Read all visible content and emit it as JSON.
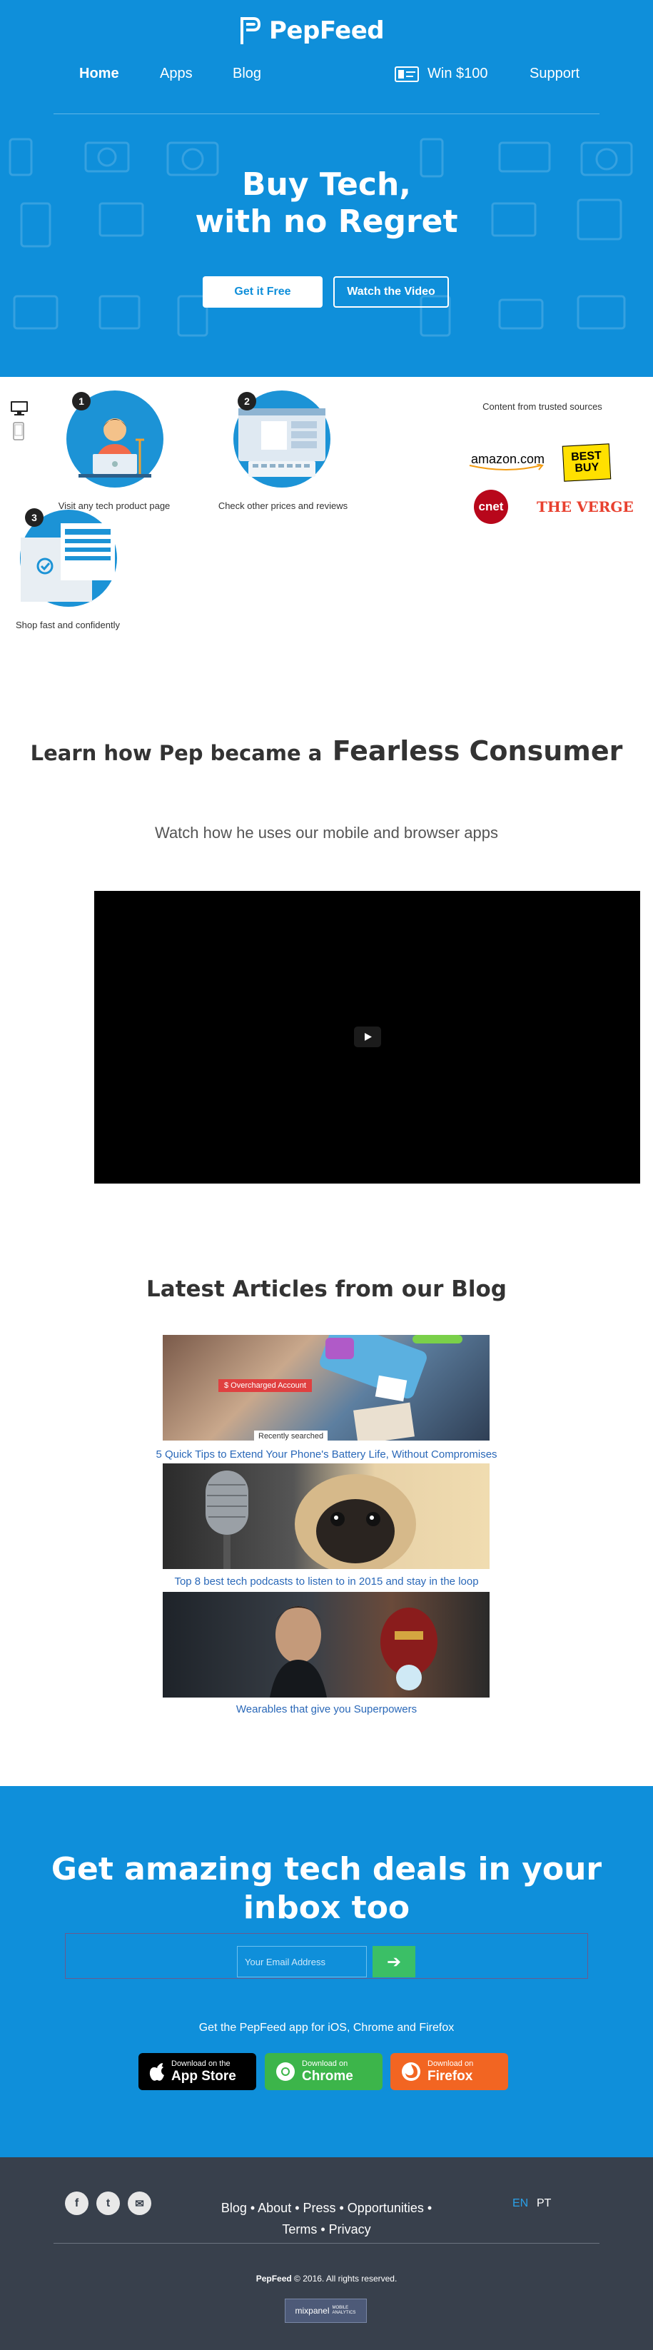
{
  "header": {
    "logo_text": "PepFeed",
    "nav": [
      {
        "label": "Home"
      },
      {
        "label": "Apps"
      },
      {
        "label": "Blog"
      },
      {
        "label": "Win $100",
        "icon": "ticket-icon"
      },
      {
        "label": "Support"
      }
    ]
  },
  "hero": {
    "title_line1": "Buy Tech,",
    "title_line2": "with no Regret",
    "cta_primary": "Get it Free",
    "cta_secondary": "Watch the Video"
  },
  "steps": {
    "device_icons": [
      "desktop-icon",
      "mobile-icon"
    ],
    "items": [
      {
        "number": "1",
        "label": "Visit any tech product page"
      },
      {
        "number": "2",
        "label": "Check other prices and reviews"
      },
      {
        "number": "3",
        "label": "Shop fast and confidently"
      }
    ],
    "trusted_title": "Content from trusted sources",
    "sources": [
      "amazon.com",
      "BEST BUY",
      "cnet",
      "THE VERGE"
    ]
  },
  "learn": {
    "title_light": "Learn how Pep became a",
    "title_bold": "Fearless Consumer",
    "subtitle": "Watch how he uses our mobile and browser apps"
  },
  "blog": {
    "title": "Latest Articles from our Blog",
    "articles": [
      {
        "title": "5 Quick Tips to Extend Your Phone's Battery Life, Without Compromises",
        "overlay_1": "$ Overcharged Account",
        "overlay_2": "Recently searched"
      },
      {
        "title": "Top 8 best tech podcasts to listen to in 2015 and stay in the loop"
      },
      {
        "title": "Wearables that give you Superpowers"
      }
    ]
  },
  "newsletter": {
    "title": "Get amazing tech deals in your inbox too",
    "email_placeholder": "Your Email Address",
    "submit_symbol": "➔",
    "apps_text": "Get the PepFeed app for iOS, Chrome and Firefox",
    "stores": [
      {
        "small": "Download on the",
        "big": "App Store",
        "color": "#000000"
      },
      {
        "small": "Download on",
        "big": "Chrome",
        "color": "#3cb54a"
      },
      {
        "small": "Download on",
        "big": "Firefox",
        "color": "#f26522"
      }
    ]
  },
  "footer": {
    "social": [
      {
        "icon": "facebook-icon",
        "glyph": "f"
      },
      {
        "icon": "twitter-icon",
        "glyph": "t"
      },
      {
        "icon": "email-icon",
        "glyph": "✉"
      }
    ],
    "links_row1": "Blog • About • Press • Opportunities •",
    "links_row2": "Terms • Privacy",
    "lang_active": "EN",
    "lang_other": "PT",
    "copyright_brand": "PepFeed",
    "copyright_rest": "© 2016. All rights reserved.",
    "badge_brand": "mixpanel",
    "badge_text": "MOBILE ANALYTICS"
  },
  "colors": {
    "brand_blue": "#0f8fda",
    "footer_bg": "#38404c",
    "link_blue": "#2a68b8",
    "submit_green": "#3bbf66"
  }
}
